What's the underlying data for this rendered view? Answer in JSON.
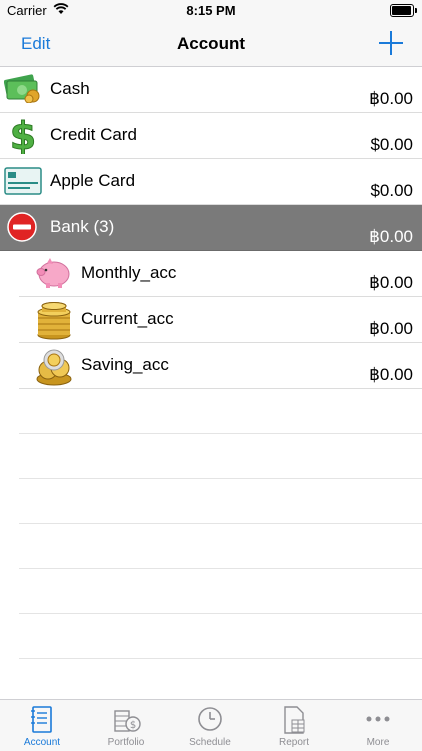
{
  "status": {
    "carrier": "Carrier",
    "time": "8:15 PM"
  },
  "nav": {
    "edit_label": "Edit",
    "title": "Account",
    "add_icon": "plus-icon"
  },
  "accounts": [
    {
      "label": "Cash",
      "amount": "฿0.00",
      "icon": "cash-icon"
    },
    {
      "label": "Credit Card",
      "amount": "$0.00",
      "icon": "dollar-icon"
    },
    {
      "label": "Apple Card",
      "amount": "$0.00",
      "icon": "credit-card-icon"
    },
    {
      "label": "Bank (3)",
      "amount": "฿0.00",
      "icon": "minus-circle-icon"
    },
    {
      "label": "Monthly_acc",
      "amount": "฿0.00",
      "icon": "piggy-bank-icon"
    },
    {
      "label": "Current_acc",
      "amount": "฿0.00",
      "icon": "coin-stack-icon"
    },
    {
      "label": "Saving_acc",
      "amount": "฿0.00",
      "icon": "coin-pile-icon"
    }
  ],
  "tabs": [
    {
      "label": "Account",
      "icon": "notebook-icon",
      "active": true
    },
    {
      "label": "Portfolio",
      "icon": "portfolio-icon",
      "active": false
    },
    {
      "label": "Schedule",
      "icon": "clock-icon",
      "active": false
    },
    {
      "label": "Report",
      "icon": "report-icon",
      "active": false
    },
    {
      "label": "More",
      "icon": "more-icon",
      "active": false
    }
  ],
  "colors": {
    "accent": "#1a7ad9",
    "group_bg": "#7a7a7a",
    "tab_inactive": "#8e8e93"
  }
}
